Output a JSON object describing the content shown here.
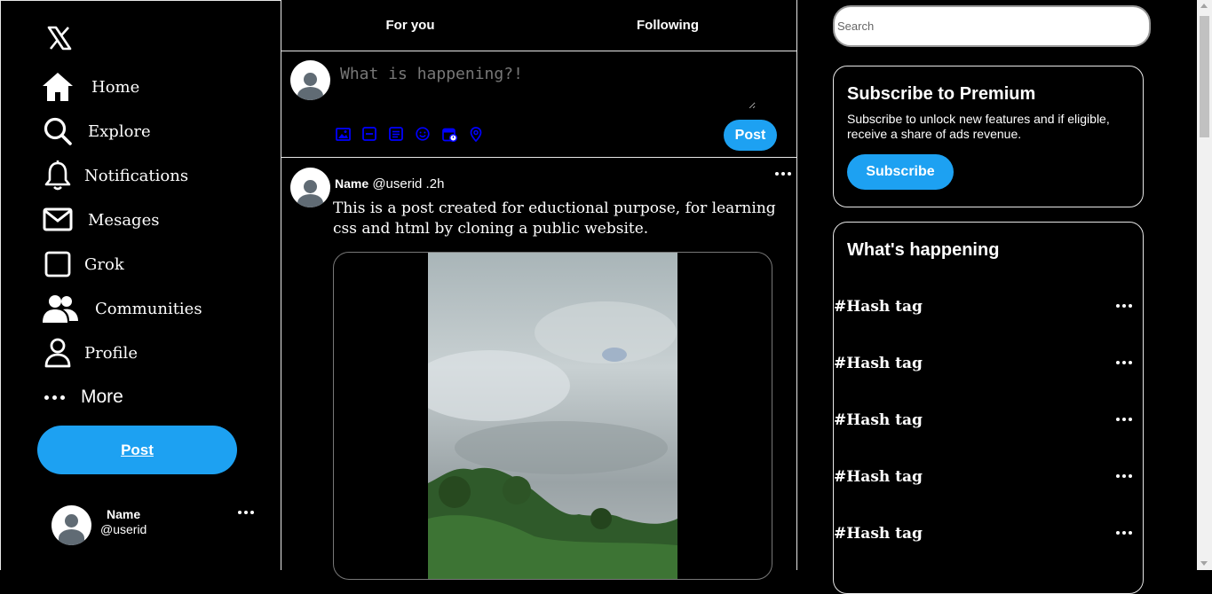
{
  "sidebar": {
    "items": [
      {
        "label": "Home",
        "icon": "home-icon"
      },
      {
        "label": "Explore",
        "icon": "search-icon"
      },
      {
        "label": "Notifications",
        "icon": "bell-icon"
      },
      {
        "label": "Mesages",
        "icon": "envelope-icon"
      },
      {
        "label": "Grok",
        "icon": "grok-icon"
      },
      {
        "label": "Communities",
        "icon": "people-icon"
      },
      {
        "label": "Profile",
        "icon": "user-icon"
      },
      {
        "label": "More",
        "icon": "more-dots-icon"
      }
    ],
    "post_label": "Post",
    "profile": {
      "name": "Name",
      "userid": "@userid"
    }
  },
  "main": {
    "tabs": [
      {
        "label": "For you"
      },
      {
        "label": "Following"
      }
    ],
    "compose": {
      "placeholder": "What is happening?!",
      "post_label": "Post",
      "tools": [
        "image-icon",
        "gif-icon",
        "poll-icon",
        "emoji-icon",
        "schedule-icon",
        "location-icon"
      ]
    },
    "tweet": {
      "name": "Name",
      "meta": "@userid .2h",
      "text": "This is a post created for eductional purpose, for learning css and html by cloning a public website."
    }
  },
  "right": {
    "search_placeholder": "Search",
    "premium": {
      "title": "Subscribe to Premium",
      "description": "Subscribe to unlock new features and if eligible, receive a share of ads revenue.",
      "button": "Subscribe"
    },
    "trends": {
      "title": "What's happening",
      "items": [
        "#Hash tag",
        "#Hash tag",
        "#Hash tag",
        "#Hash tag",
        "#Hash tag"
      ]
    }
  },
  "colors": {
    "accent": "#1da1f2",
    "background": "#000000",
    "border": "#e7e7e7",
    "tool_icon": "#0000ff"
  }
}
